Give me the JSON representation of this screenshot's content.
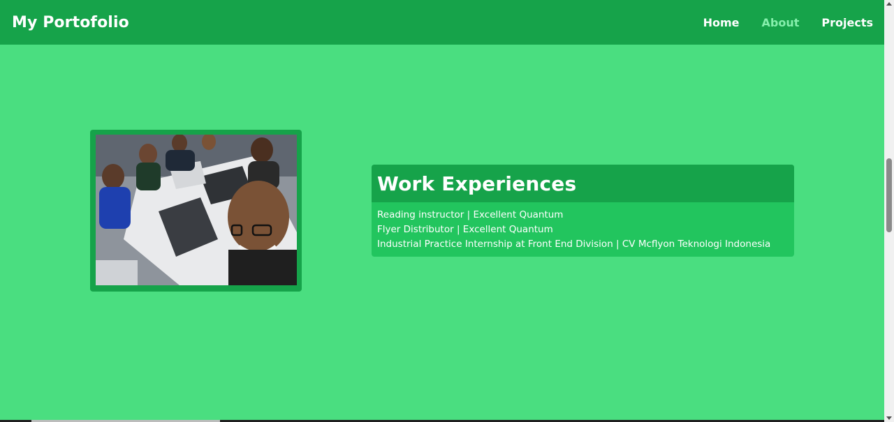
{
  "navbar": {
    "brand": "My Portofolio",
    "links": [
      {
        "label": "Home",
        "active": false
      },
      {
        "label": "About",
        "active": true
      },
      {
        "label": "Projects",
        "active": false
      }
    ]
  },
  "work": {
    "title": "Work Experiences",
    "items": [
      "Reading instructor | Excellent Quantum",
      "Flyer Distributor | Excellent Quantum",
      "Industrial Practice Internship at Front End Division | CV Mcflyon Teknologi Indonesia"
    ]
  },
  "colors": {
    "background": "#4ade80",
    "navbar": "#16a34a",
    "card": "#22c55e",
    "active_link": "#86efac"
  },
  "icons": {
    "scroll_up": "scroll-up-arrow-icon",
    "scroll_down": "scroll-down-arrow-icon"
  }
}
